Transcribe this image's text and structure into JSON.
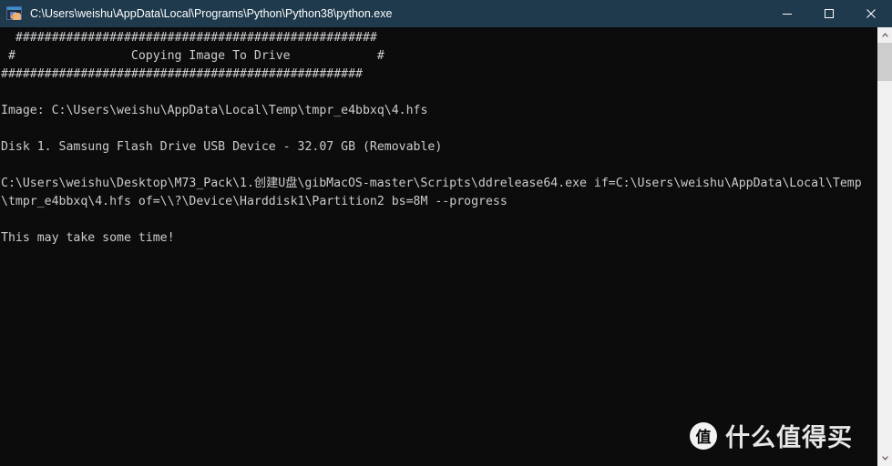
{
  "window": {
    "title": "C:\\Users\\weishu\\AppData\\Local\\Programs\\Python\\Python38\\python.exe",
    "icon": "python-console-icon",
    "titlebar_color": "#1f3a4d",
    "console_bg": "#0c0c0c",
    "console_fg": "#ccccd0",
    "controls": {
      "minimize": "minimize-button",
      "maximize": "maximize-button",
      "close": "close-button"
    }
  },
  "console": {
    "lines": [
      "  ##################################################",
      " #                Copying Image To Drive            #",
      "##################################################",
      "",
      "Image: C:\\Users\\weishu\\AppData\\Local\\Temp\\tmpr_e4bbxq\\4.hfs",
      "",
      "Disk 1. Samsung Flash Drive USB Device - 32.07 GB (Removable)",
      "",
      "C:\\Users\\weishu\\Desktop\\M73_Pack\\1.创建U盘\\gibMacOS-master\\Scripts\\ddrelease64.exe if=C:\\Users\\weishu\\AppData\\Local\\Temp",
      "\\tmpr_e4bbxq\\4.hfs of=\\\\?\\Device\\Harddisk1\\Partition2 bs=8M --progress",
      "",
      "This may take some time!"
    ],
    "banner_title": "Copying Image To Drive",
    "image_path": "C:\\Users\\weishu\\AppData\\Local\\Temp\\tmpr_e4bbxq\\4.hfs",
    "disk_label": "Disk 1. Samsung Flash Drive USB Device - 32.07 GB (Removable)",
    "status_message": "This may take some time!"
  },
  "scrollbar": {
    "up_arrow": "scroll-up-arrow",
    "down_arrow": "scroll-down-arrow",
    "thumb": "scroll-thumb",
    "track_color": "#f0f0f0",
    "thumb_color": "#cdcdcd"
  },
  "watermark": {
    "logo_glyph": "值",
    "text": "什么值得买"
  }
}
